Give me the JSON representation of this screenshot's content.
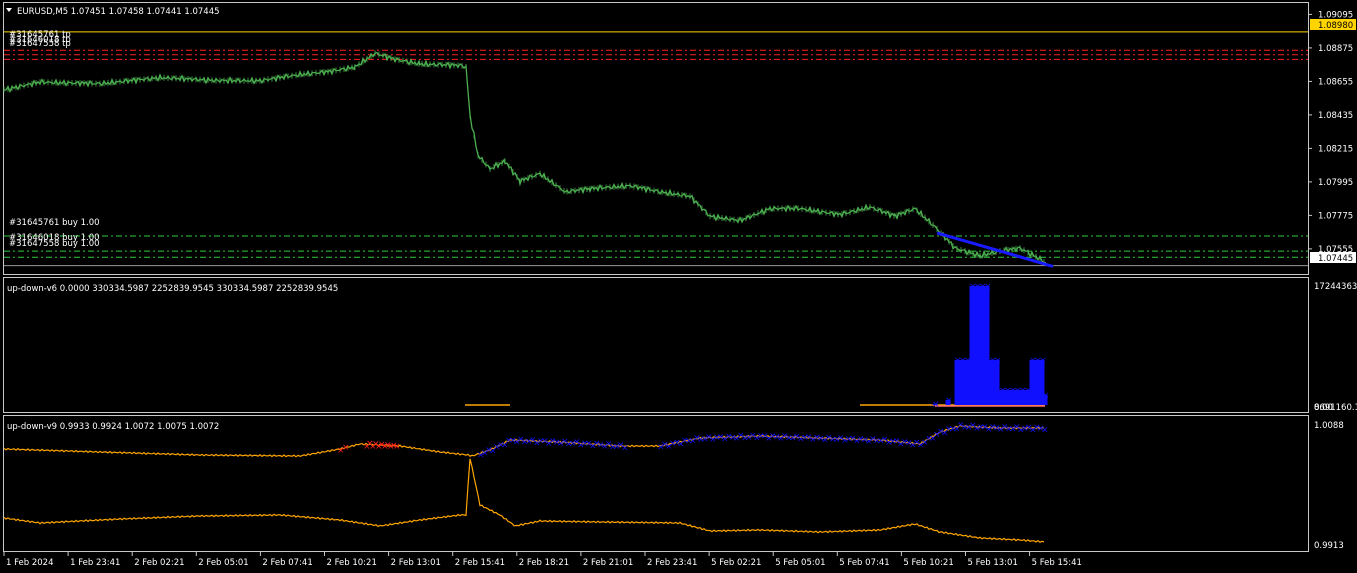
{
  "main_panel": {
    "header": "EURUSD,M5  1.07451 1.07458 1.07441 1.07445",
    "price_ticks": [
      "1.09095",
      "1.08875",
      "1.08655",
      "1.08435",
      "1.08215",
      "1.07995",
      "1.07775",
      "1.07555"
    ],
    "ylim": [
      1.0739,
      1.0917
    ],
    "tp_labels": [
      "#31645761 tp",
      "#31646018 tp",
      "#31647558 tp"
    ],
    "buy_labels": [
      "#31645761 buy 1.00",
      "#31646018 buy 1.00",
      "#31647558 buy 1.00"
    ],
    "tp_levels": [
      1.0886,
      1.0883,
      1.088
    ],
    "buy_levels": [
      1.0764,
      1.0754,
      1.075
    ],
    "current_price": "1.07445",
    "current_level": 1.07445,
    "highlight_price": "1.08980",
    "highlight_level": 1.0898,
    "colors": {
      "candles": "#4caf50",
      "tp_line": "#ff2020",
      "buy_line": "#2ecc40",
      "trend": "#1a1aff",
      "highlight": "#ffd400"
    }
  },
  "indicator1": {
    "header": "up-down-v6 0.0000 330334.5987 2252839.9545 330334.5987 2252839.9545",
    "top_label": "17244363.",
    "bottom_label": "8691160.1",
    "bottom_label_overlap": "0.00",
    "colors": {
      "bars": "#1010ff",
      "base": "#ffa500",
      "pink": "#ff7070"
    }
  },
  "indicator2": {
    "header": "up-down-v9 0.9933 0.9924 1.0072 1.0075 1.0072",
    "top_label": "1.0088",
    "bottom_label": "0.9913",
    "colors": {
      "line": "#ffa500",
      "up_marks": "#1010ff",
      "down_marks": "#ff2020"
    }
  },
  "time_axis": [
    "1 Feb 2024",
    "1 Feb 23:41",
    "2 Feb 02:21",
    "2 Feb 05:01",
    "2 Feb 07:41",
    "2 Feb 10:21",
    "2 Feb 13:01",
    "2 Feb 15:41",
    "2 Feb 18:21",
    "2 Feb 21:01",
    "2 Feb 23:41",
    "5 Feb 02:21",
    "5 Feb 05:01",
    "5 Feb 07:41",
    "5 Feb 10:21",
    "5 Feb 13:01",
    "5 Feb 15:41"
  ]
}
